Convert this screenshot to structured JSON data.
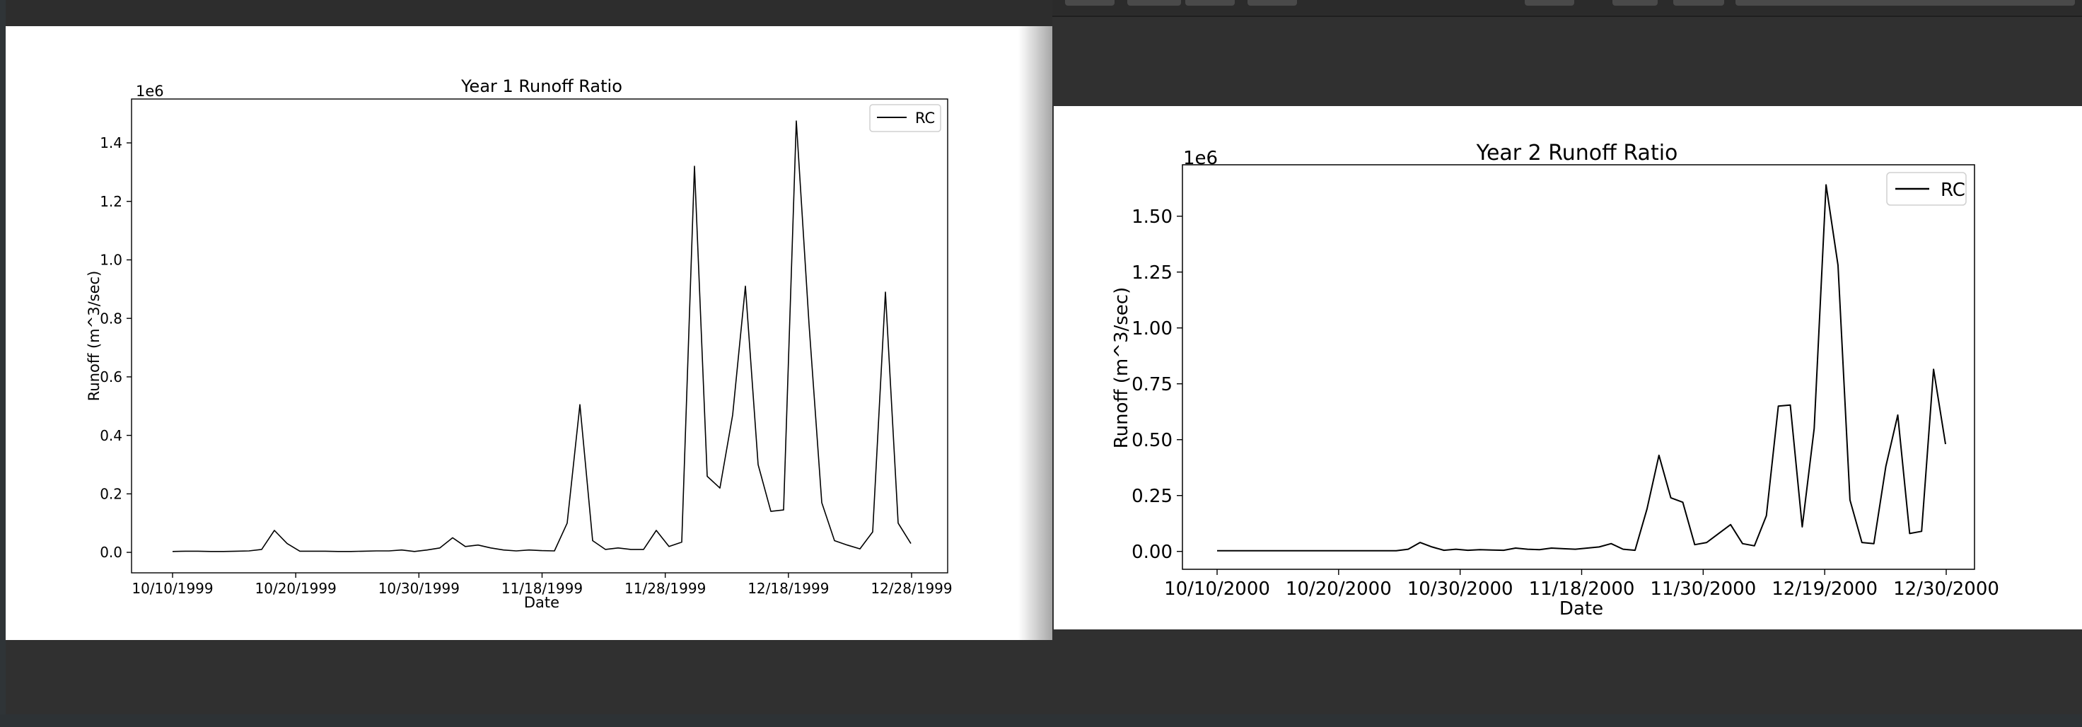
{
  "chart_data": [
    {
      "type": "line",
      "title": "Year 1 Runoff Ratio",
      "xlabel": "Date",
      "ylabel": "Runoff (m^3/sec)",
      "y_offset_label": "1e6",
      "yticks": [
        "0.0",
        "0.2",
        "0.4",
        "0.6",
        "0.8",
        "1.0",
        "1.2",
        "1.4"
      ],
      "ytick_values": [
        0.0,
        0.2,
        0.4,
        0.6,
        0.8,
        1.0,
        1.2,
        1.4
      ],
      "ylim": [
        -0.07,
        1.55
      ],
      "xticks": [
        "10/10/1999",
        "10/20/1999",
        "10/30/1999",
        "11/18/1999",
        "11/28/1999",
        "12/18/1999",
        "12/28/1999"
      ],
      "grid": false,
      "legend_position": "top-right",
      "series": [
        {
          "name": "RC",
          "color": "#000000",
          "values": [
            0.003,
            0.004,
            0.004,
            0.003,
            0.003,
            0.004,
            0.005,
            0.01,
            0.075,
            0.03,
            0.004,
            0.004,
            0.004,
            0.003,
            0.003,
            0.004,
            0.005,
            0.005,
            0.008,
            0.003,
            0.008,
            0.015,
            0.05,
            0.02,
            0.025,
            0.015,
            0.008,
            0.005,
            0.008,
            0.006,
            0.005,
            0.1,
            0.505,
            0.04,
            0.01,
            0.015,
            0.01,
            0.01,
            0.075,
            0.02,
            0.035,
            1.32,
            0.26,
            0.22,
            0.47,
            0.91,
            0.3,
            0.14,
            0.145,
            1.475,
            0.78,
            0.17,
            0.04,
            0.025,
            0.012,
            0.07,
            0.89,
            0.1,
            0.03
          ]
        }
      ]
    },
    {
      "type": "line",
      "title": "Year 2 Runoff Ratio",
      "xlabel": "Date",
      "ylabel": "Runoff (m^3/sec)",
      "y_offset_label": "1e6",
      "yticks": [
        "0.00",
        "0.25",
        "0.50",
        "0.75",
        "1.00",
        "1.25",
        "1.50"
      ],
      "ytick_values": [
        0.0,
        0.25,
        0.5,
        0.75,
        1.0,
        1.25,
        1.5
      ],
      "ylim": [
        -0.08,
        1.73
      ],
      "xticks": [
        "10/10/2000",
        "10/20/2000",
        "10/30/2000",
        "11/18/2000",
        "11/30/2000",
        "12/19/2000",
        "12/30/2000"
      ],
      "grid": false,
      "legend_position": "top-right",
      "series": [
        {
          "name": "RC",
          "color": "#000000",
          "values": [
            0.003,
            0.003,
            0.003,
            0.003,
            0.003,
            0.003,
            0.003,
            0.003,
            0.003,
            0.003,
            0.003,
            0.003,
            0.003,
            0.003,
            0.003,
            0.003,
            0.01,
            0.04,
            0.02,
            0.005,
            0.01,
            0.005,
            0.008,
            0.006,
            0.005,
            0.015,
            0.01,
            0.008,
            0.015,
            0.012,
            0.01,
            0.015,
            0.02,
            0.035,
            0.01,
            0.005,
            0.19,
            0.43,
            0.24,
            0.22,
            0.03,
            0.04,
            0.08,
            0.12,
            0.035,
            0.025,
            0.16,
            0.65,
            0.655,
            0.11,
            0.55,
            1.64,
            1.28,
            0.23,
            0.04,
            0.035,
            0.38,
            0.61,
            0.08,
            0.09,
            0.815,
            0.48
          ]
        }
      ]
    }
  ]
}
